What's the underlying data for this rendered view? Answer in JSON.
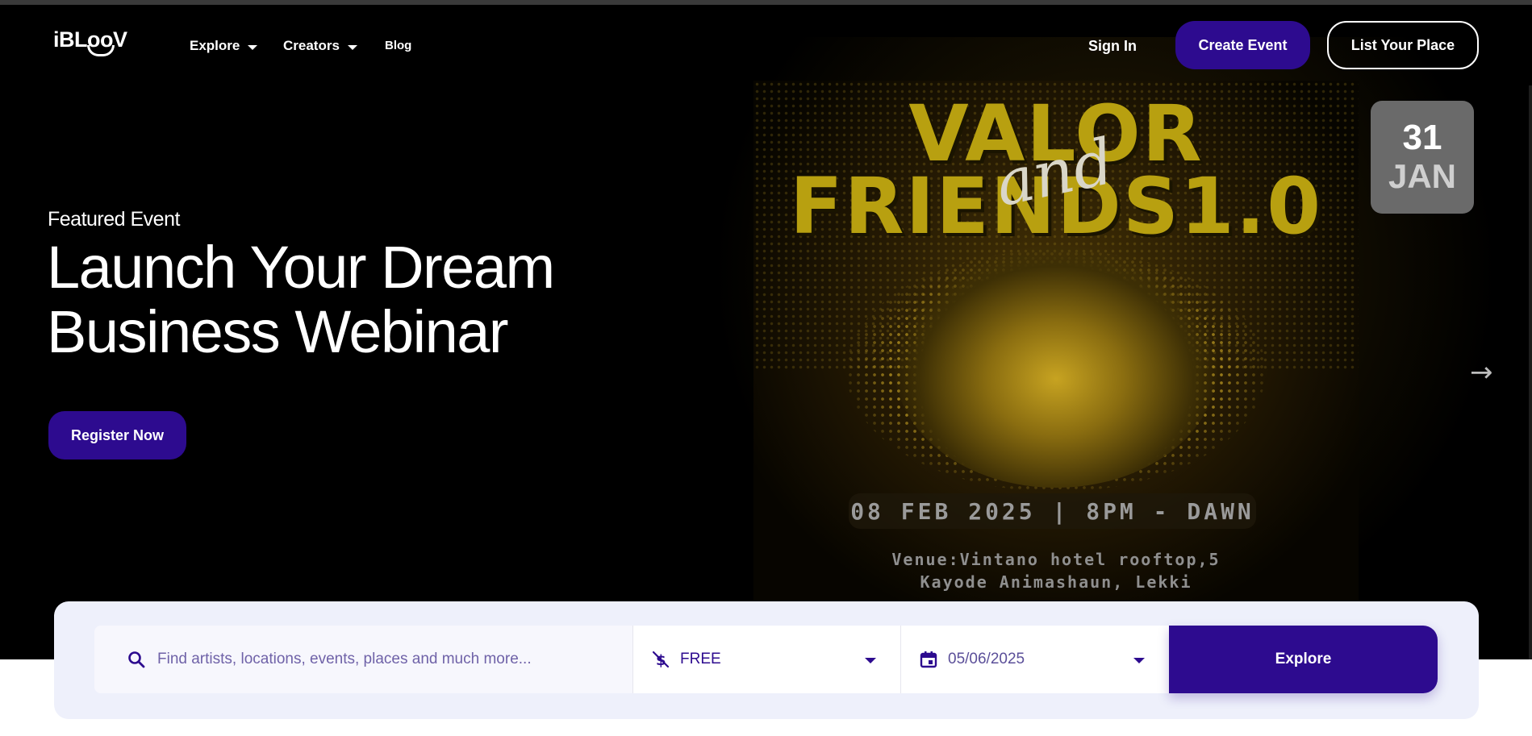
{
  "nav": {
    "logo": "iBLooV",
    "items": [
      {
        "label": "Explore",
        "has_dropdown": true
      },
      {
        "label": "Creators",
        "has_dropdown": true
      },
      {
        "label": "Blog",
        "has_dropdown": false
      }
    ],
    "sign_in": "Sign In",
    "create_event": "Create Event",
    "list_place": "List Your Place"
  },
  "hero": {
    "eyebrow": "Featured Event",
    "title_line1": "Launch Your Dream",
    "title_line2": "Business Webinar",
    "cta": "Register Now",
    "poster": {
      "title_line1": "VALOR",
      "title_line2": "FRIENDS1.0",
      "script_word": "and",
      "date_line": "08 FEB 2025 | 8PM - DAWN",
      "venue_line1": "Venue:Vintano hotel rooftop,5",
      "venue_line2": "Kayode Animashaun, Lekki"
    },
    "date_badge": {
      "day": "31",
      "month": "JAN"
    },
    "next_icon": "arrow-right-icon"
  },
  "search": {
    "placeholder": "Find artists, locations, events, places and much more...",
    "price_value": "FREE",
    "date_value": "05/06/2025",
    "explore_label": "Explore"
  },
  "colors": {
    "primary": "#2d0b8f",
    "hero_bg": "#000000",
    "poster_gold": "#b8a010",
    "search_panel_bg": "#eef0fb"
  }
}
